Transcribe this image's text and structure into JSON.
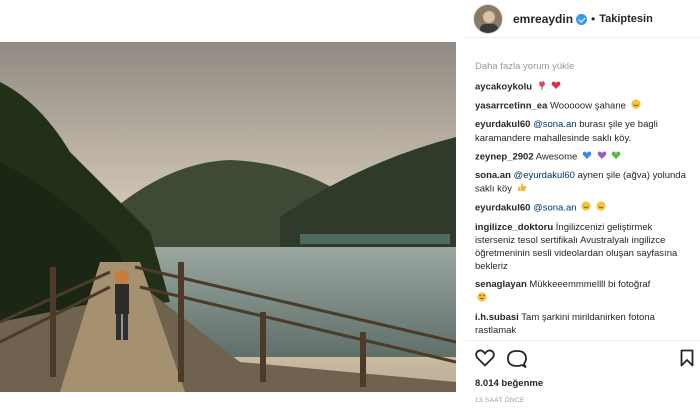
{
  "post": {
    "username": "emreaydin",
    "separator": "•",
    "follow_status": "Takiptesin"
  },
  "load_more": "Daha fazla yorum yükle",
  "comments": [
    {
      "user": "aycakoykolu",
      "text": ""
    },
    {
      "user": "yasarrcetinn_ea",
      "text": "Wooooow şahane"
    },
    {
      "user": "eyurdakul60",
      "mention": "@sona.an",
      "text": "burası şile ye bagli karamandere mahallesinde saklı köy."
    },
    {
      "user": "zeynep_2902",
      "text": "Awesome"
    },
    {
      "user": "sona.an",
      "mention": "@eyurdakul60",
      "text": "aynen şile (ağva) yolunda saklı köy"
    },
    {
      "user": "eyurdakul60",
      "mention": "@sona.an",
      "text": ""
    },
    {
      "user": "ingilizce_doktoru",
      "text": "İngilizcenizi geliştirmek isterseniz tesol sertifikalı Avustralyalı ingilizce öğretmeninin sesli videolardan oluşan sayfasına bekleriz"
    },
    {
      "user": "senaglayan",
      "text": "Mükkeeemmmellll bi fotoğraf"
    },
    {
      "user": "i.h.subasi",
      "text": "Tam şarkini mirildanirken fotona rastlamak"
    }
  ],
  "likes": {
    "count": "8.014",
    "label": "beğenme"
  },
  "timestamp": "13 SAAT ÖNCE",
  "icons": [
    "heart-icon",
    "comment-icon",
    "bookmark-icon",
    "verified-badge-icon"
  ],
  "colors": {
    "mention": "#003569",
    "verified": "#3897f0",
    "muted": "#999999"
  }
}
